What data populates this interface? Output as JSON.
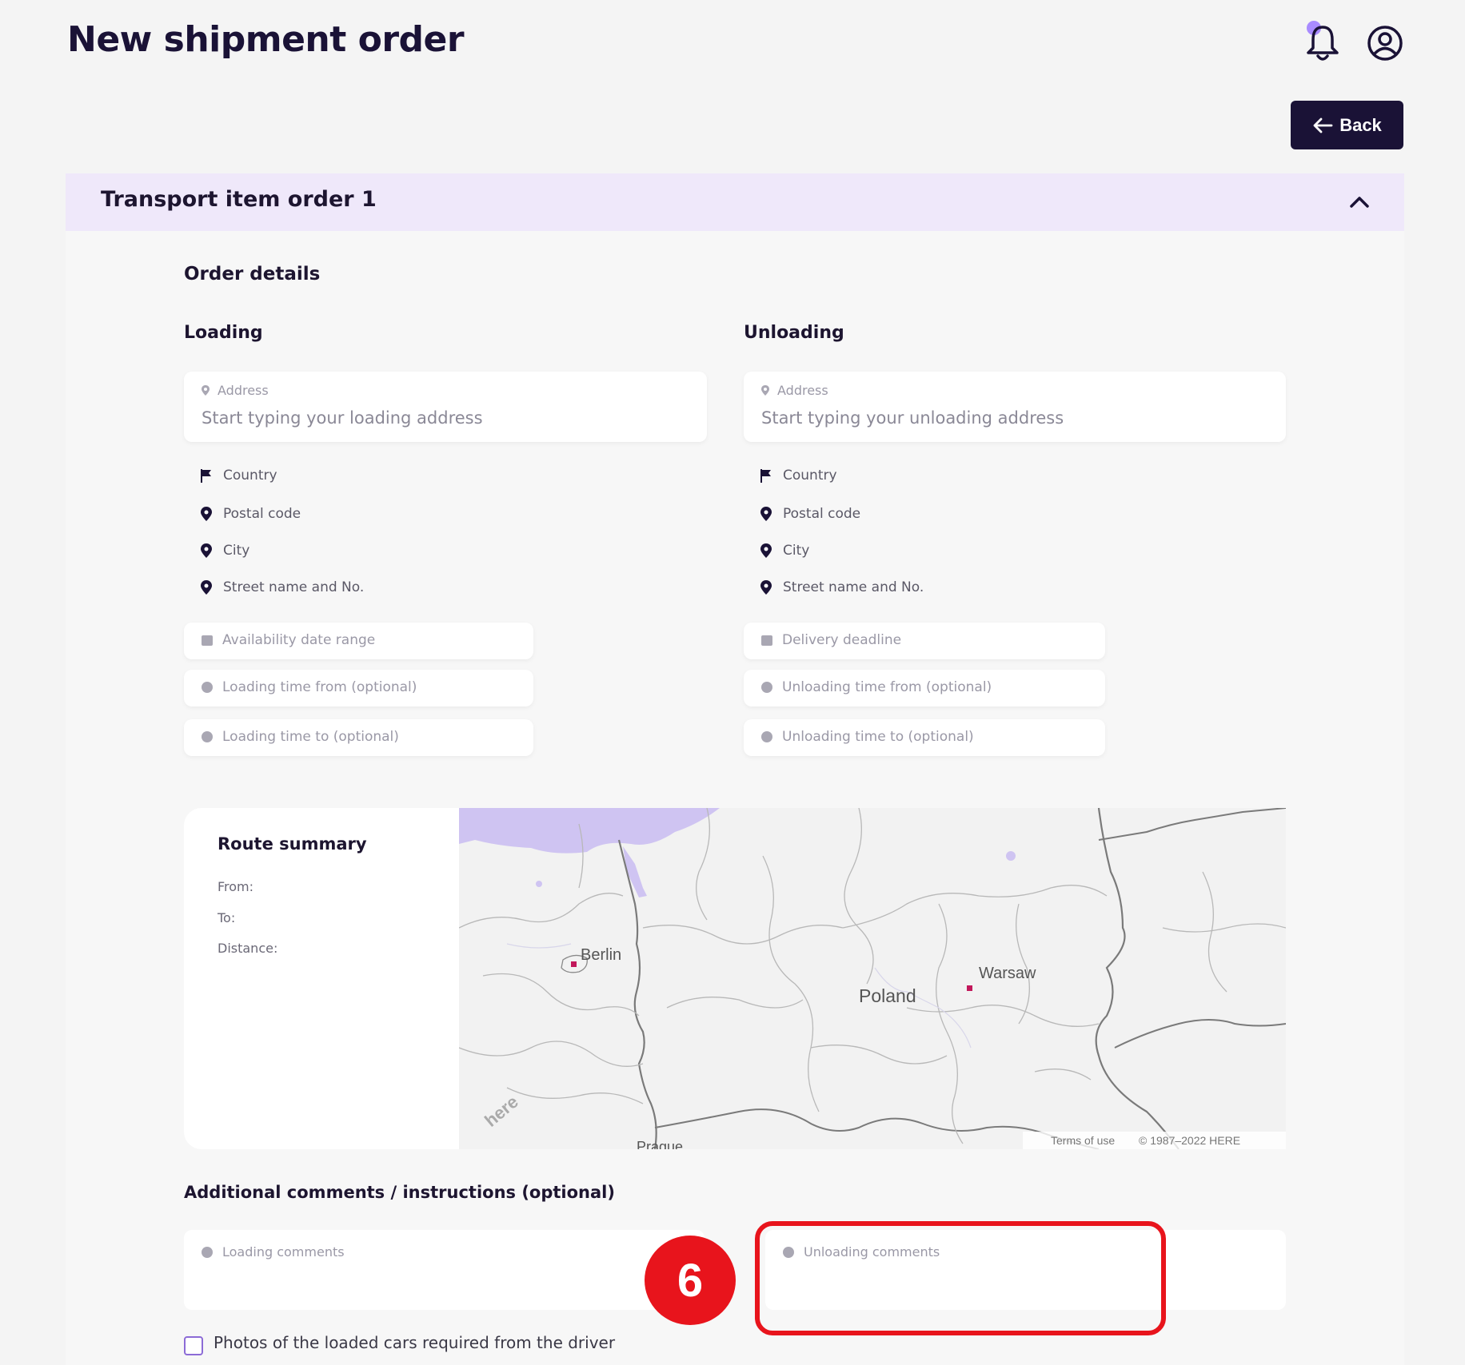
{
  "header": {
    "title": "New shipment order",
    "back_label": "Back"
  },
  "accordion": {
    "title": "Transport item order 1"
  },
  "order_details": {
    "title": "Order details",
    "loading": {
      "title": "Loading",
      "address_label": "Address",
      "address_placeholder": "Start typing your loading address",
      "country": "Country",
      "postal_code": "Postal code",
      "city": "City",
      "street": "Street name and No.",
      "date_field": "Availability date range",
      "time_from": "Loading time from (optional)",
      "time_to": "Loading time to (optional)"
    },
    "unloading": {
      "title": "Unloading",
      "address_label": "Address",
      "address_placeholder": "Start typing your unloading address",
      "country": "Country",
      "postal_code": "Postal code",
      "city": "City",
      "street": "Street name and No.",
      "date_field": "Delivery deadline",
      "time_from": "Unloading time from (optional)",
      "time_to": "Unloading time to (optional)"
    }
  },
  "route_summary": {
    "title": "Route summary",
    "from_label": "From:",
    "to_label": "To:",
    "distance_label": "Distance:",
    "map": {
      "labels": {
        "berlin": "Berlin",
        "poland": "Poland",
        "warsaw": "Warsaw",
        "prague": "Prague",
        "here_logo": "here"
      },
      "terms": "Terms of use",
      "copyright": "© 1987–2022 HERE"
    }
  },
  "comments": {
    "title": "Additional comments / instructions (optional)",
    "loading_label": "Loading comments",
    "unloading_label": "Unloading comments"
  },
  "photos_checkbox": {
    "label": "Photos of the loaded cars required from the driver",
    "checked": false
  },
  "annotation": {
    "step_number": "6",
    "color": "#e8141c"
  },
  "colors": {
    "primary_dark": "#1a1236",
    "accent_lavender": "#efe8fa",
    "checkbox_border": "#8c6bd6",
    "notification_dot": "#a98bff"
  }
}
